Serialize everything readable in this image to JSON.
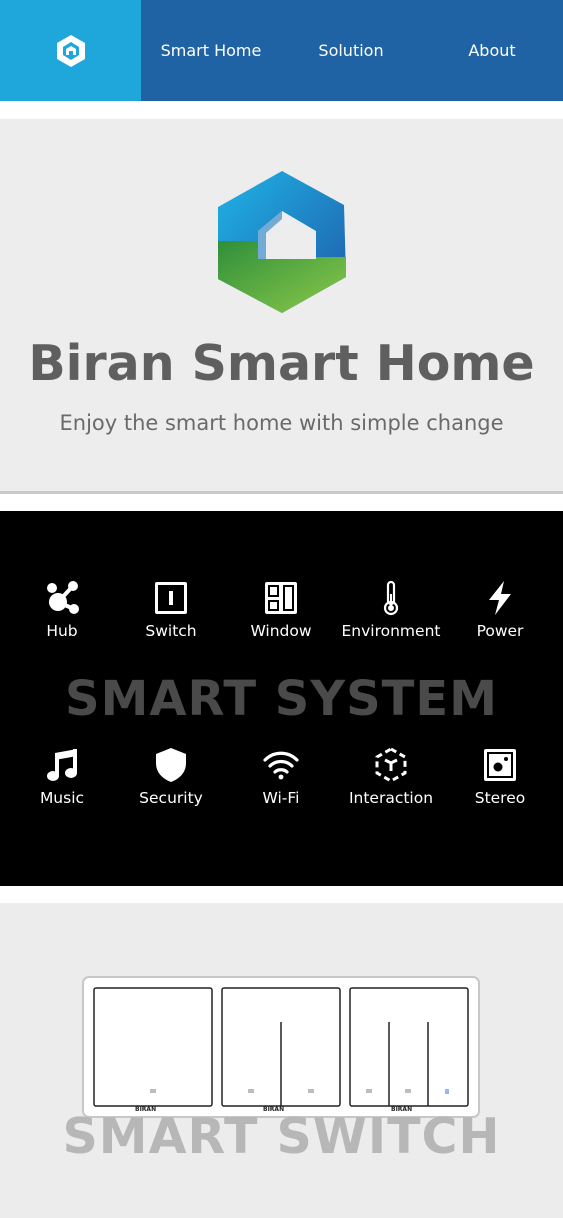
{
  "nav": {
    "logo_icon": "cube-home-icon",
    "links": [
      "Smart Home",
      "Solution",
      "About"
    ],
    "colors": {
      "logo_bg": "#1fa7dc",
      "bar_bg": "#2063a5"
    }
  },
  "hero": {
    "logo_icon": "biran-hexagon-home-logo",
    "title": "Biran Smart Home",
    "subtitle": "Enjoy the smart home with simple change"
  },
  "system": {
    "title": "SMART SYSTEM",
    "top_features": [
      {
        "label": "Hub",
        "icon": "hub-icon"
      },
      {
        "label": "Switch",
        "icon": "switch-icon"
      },
      {
        "label": "Window",
        "icon": "window-icon"
      },
      {
        "label": "Environment",
        "icon": "thermometer-icon"
      },
      {
        "label": "Power",
        "icon": "bolt-icon"
      }
    ],
    "bottom_features": [
      {
        "label": "Music",
        "icon": "music-note-icon"
      },
      {
        "label": "Security",
        "icon": "shield-icon"
      },
      {
        "label": "Wi-Fi",
        "icon": "wifi-icon"
      },
      {
        "label": "Interaction",
        "icon": "cube-interaction-icon"
      },
      {
        "label": "Stereo",
        "icon": "speaker-icon"
      }
    ]
  },
  "switch_section": {
    "title": "SMART SWITCH",
    "panel_brand": "BIRAN",
    "gangs": [
      1,
      2,
      3
    ]
  }
}
